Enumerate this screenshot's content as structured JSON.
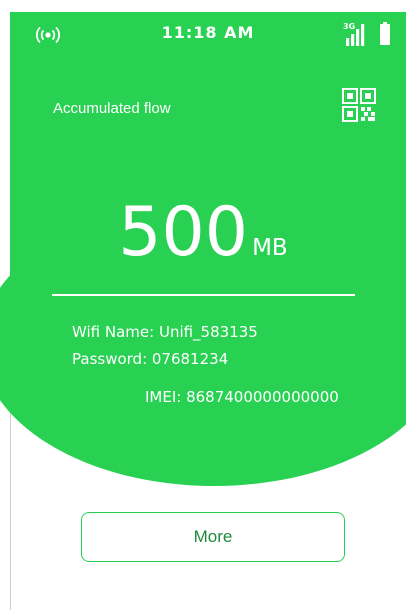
{
  "status_bar": {
    "time": "11:18 AM",
    "network_type": "3G",
    "left_icon": "broadcast-signal-icon",
    "signal_icon": "cell-signal-bars-icon",
    "battery_icon": "battery-icon"
  },
  "header": {
    "label": "Accumulated flow",
    "qr_icon": "qr-code-icon"
  },
  "usage": {
    "value": "500",
    "unit": "MB"
  },
  "device_info": {
    "wifi_name": "Wifi Name: Unifi_583135",
    "password": "Password: 07681234",
    "imei": "IMEI: 8687400000000000"
  },
  "actions": {
    "more_label": "More"
  },
  "colors": {
    "accent": "#28d152",
    "button_text": "#1f8a3a",
    "background": "#ffffff"
  }
}
